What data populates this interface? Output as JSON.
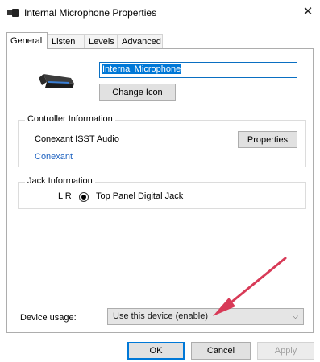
{
  "window": {
    "title": "Internal Microphone Properties",
    "close_glyph": "✕"
  },
  "tabs": [
    {
      "label": "General",
      "active": true
    },
    {
      "label": "Listen",
      "active": false
    },
    {
      "label": "Levels",
      "active": false
    },
    {
      "label": "Advanced",
      "active": false
    }
  ],
  "device": {
    "name": "Internal Microphone",
    "change_icon_label": "Change Icon"
  },
  "controller": {
    "title": "Controller Information",
    "name": "Conexant ISST Audio",
    "properties_label": "Properties",
    "vendor_link": "Conexant"
  },
  "jack": {
    "title": "Jack Information",
    "channels": "L R",
    "description": "Top Panel Digital Jack"
  },
  "usage": {
    "label": "Device usage:",
    "value": "Use this device (enable)"
  },
  "footer": {
    "ok": "OK",
    "cancel": "Cancel",
    "apply": "Apply"
  },
  "colors": {
    "accent": "#0078d7",
    "annotation_arrow": "#d83a57"
  }
}
